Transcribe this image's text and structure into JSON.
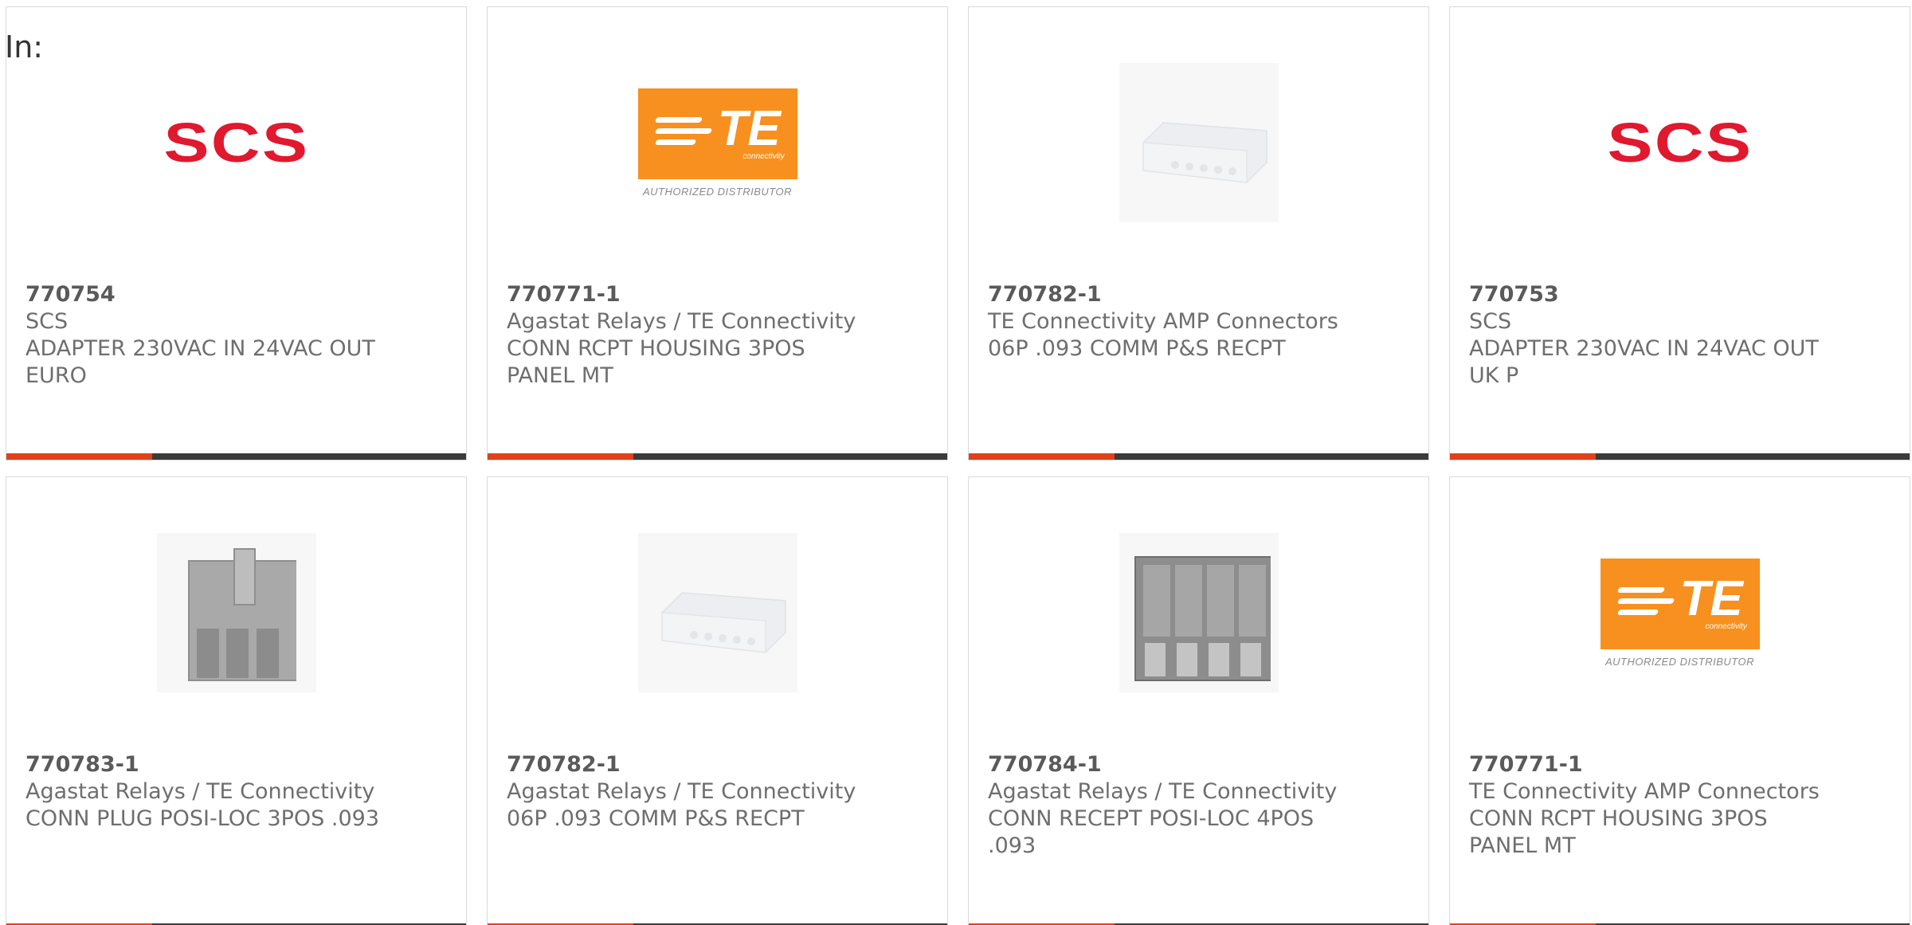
{
  "header": {
    "in_label": "In:"
  },
  "products": [
    {
      "part": "770754",
      "brand": "SCS",
      "desc": [
        "ADAPTER 230VAC IN 24VAC OUT",
        "EURO"
      ],
      "image": "scs-logo",
      "logo_text": "SCS"
    },
    {
      "part": "770771-1",
      "brand": "Agastat Relays / TE Connectivity",
      "desc": [
        "CONN RCPT HOUSING 3POS",
        "PANEL MT"
      ],
      "image": "te-logo",
      "logo_text": "TE",
      "logo_sub": "connectivity",
      "logo_caption": "AUTHORIZED DISTRIBUTOR"
    },
    {
      "part": "770782-1",
      "brand": "TE Connectivity AMP Connectors",
      "desc": [
        "06P .093 COMM P&S RECPT"
      ],
      "image": "white-receptacle-photo"
    },
    {
      "part": "770753",
      "brand": "SCS",
      "desc": [
        "ADAPTER 230VAC IN 24VAC OUT",
        "UK P"
      ],
      "image": "scs-logo",
      "logo_text": "SCS"
    },
    {
      "part": "770783-1",
      "brand": "Agastat Relays / TE Connectivity",
      "desc": [
        "CONN PLUG POSI-LOC 3POS .093"
      ],
      "image": "gray-plug-photo"
    },
    {
      "part": "770782-1",
      "brand": "Agastat Relays / TE Connectivity",
      "desc": [
        "06P .093 COMM P&S RECPT"
      ],
      "image": "white-receptacle-photo"
    },
    {
      "part": "770784-1",
      "brand": "Agastat Relays / TE Connectivity",
      "desc": [
        "CONN RECEPT POSI-LOC 4POS",
        ".093"
      ],
      "image": "gray-receptacle-photo"
    },
    {
      "part": "770771-1",
      "brand": "TE Connectivity AMP Connectors",
      "desc": [
        "CONN RCPT HOUSING 3POS",
        "PANEL MT"
      ],
      "image": "te-logo",
      "logo_text": "TE",
      "logo_sub": "connectivity",
      "logo_caption": "AUTHORIZED DISTRIBUTOR"
    }
  ],
  "colors": {
    "accent": "#e0411c",
    "bar": "#3b3b3b",
    "scs_red": "#e0192e",
    "te_orange": "#f7901e"
  }
}
